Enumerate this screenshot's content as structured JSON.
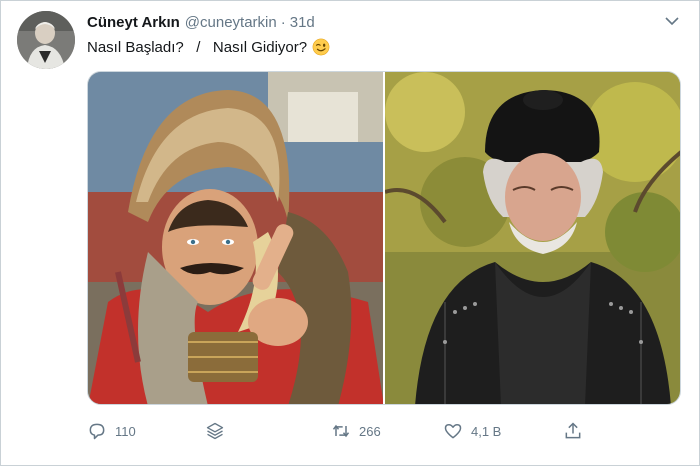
{
  "tweet": {
    "display_name": "Cüneyt Arkın",
    "handle": "@cuneytarkin",
    "separator": "·",
    "time": "31d",
    "text": "Nasıl Başladı?   /   Nasıl Gidiyor?",
    "emoji": "winking-face-emoji",
    "menu_icon": "chevron-down-icon"
  },
  "media": {
    "left_image": "young-warrior-fur-hat-pointing",
    "right_image": "old-man-black-turban"
  },
  "actions": {
    "reply_count": "110",
    "retweet_count": "266",
    "like_count": "4,1 B"
  },
  "colors": {
    "text": "#14171a",
    "secondary": "#657786",
    "border": "#ccd6dd"
  }
}
